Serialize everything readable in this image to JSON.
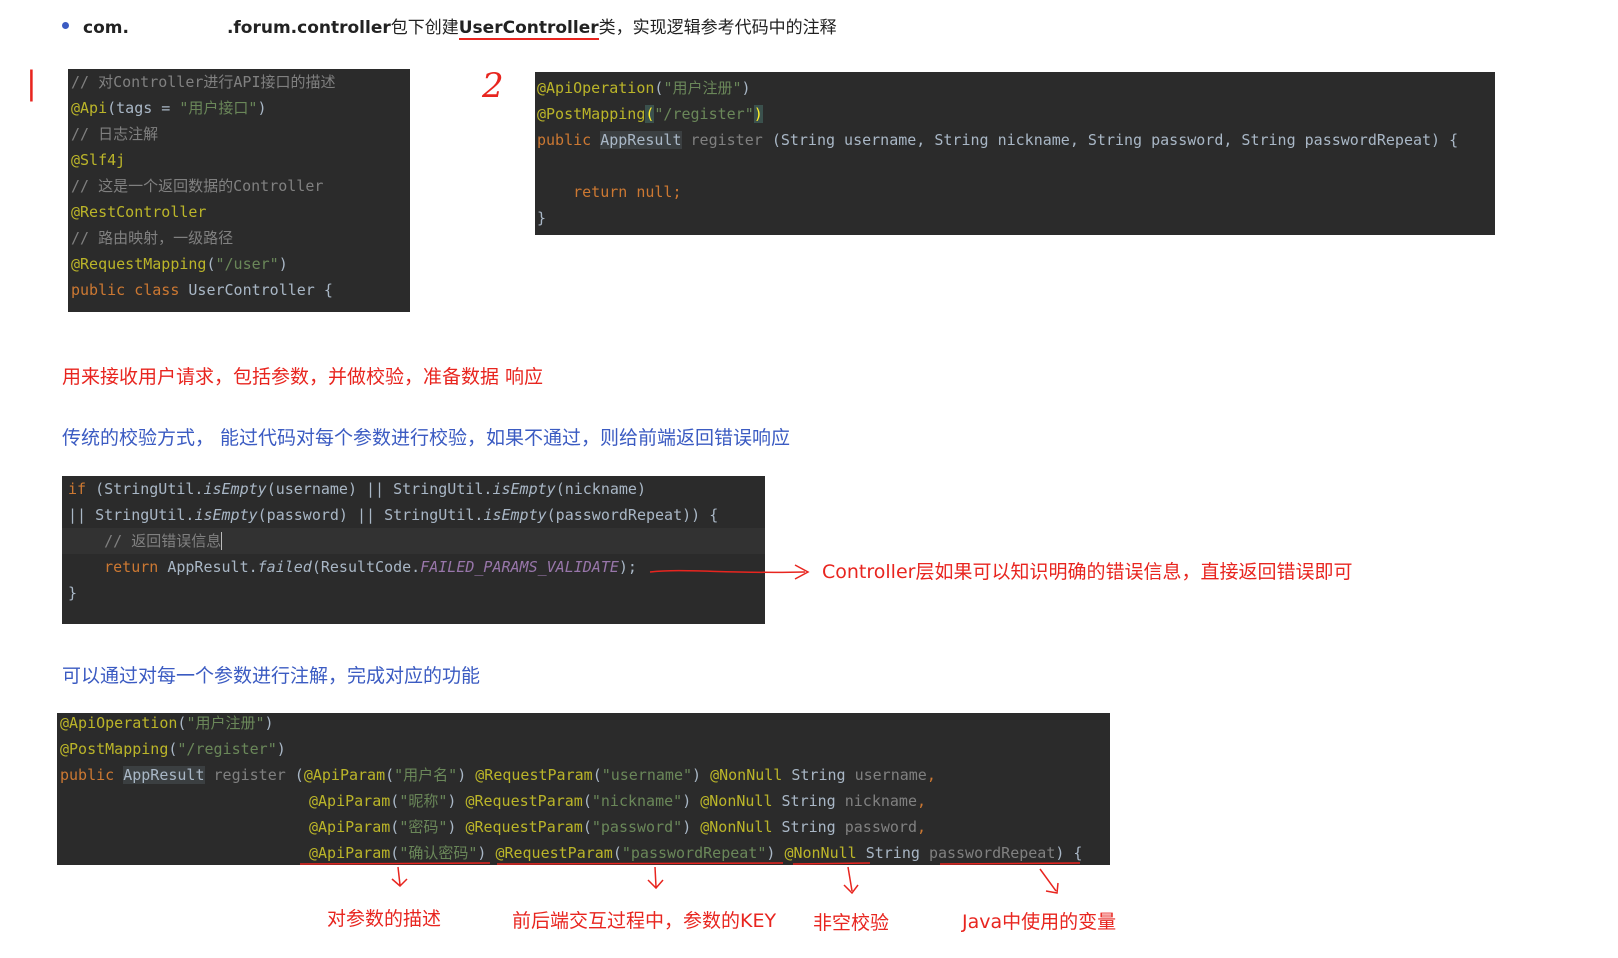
{
  "top_bullet": {
    "pkg_prefix": "com.",
    "pkg_suffix": ".forum.controller",
    "text1": "包下创建",
    "class_name": "UserController",
    "text2": "类，实现逻辑参考代码中的注释"
  },
  "handwritten_marks": {
    "mark1": "|",
    "mark2": "2"
  },
  "code_block_1": {
    "lines": [
      "// 对Controller进行API接口的描述",
      "@Api(tags = \"用户接口\")",
      "// 日志注解",
      "@Slf4j",
      "// 这是一个返回数据的Controller",
      "@RestController",
      "// 路由映射，一级路径",
      "@RequestMapping(\"/user\")",
      "public class UserController {"
    ]
  },
  "code_block_2": {
    "api_operation": "@ApiOperation",
    "api_operation_arg": "\"用户注册\"",
    "post_mapping": "@PostMapping",
    "post_mapping_arg": "\"/register\"",
    "kw_public": "public",
    "type_appresult": "AppResult",
    "method": "register",
    "params": "(String username, String nickname, String password, String passwordRepeat) {",
    "kw_return": "return",
    "ret_val": " null;",
    "close": "}"
  },
  "notes": {
    "note1": "用来接收用户请求，包括参数，并做校验，准备数据   响应",
    "note2": "传统的校验方式，  能过代码对每个参数进行校验，如果不通过，则给前端返回错误响应",
    "note3": "Controller层如果可以知识明确的错误信息，直接返回错误即可",
    "note4": "可以通过对每一个参数进行注解，完成对应的功能"
  },
  "code_block_3": {
    "kw_if": "if",
    "line1_rest": " (StringUtil.",
    "is_empty": "isEmpty",
    "arg_username": "(username) || StringUtil.",
    "arg_nickname": "(nickname)",
    "line2_a": "|| StringUtil.",
    "arg_password": "(password) || StringUtil.",
    "arg_repeat": "(passwordRepeat)) {",
    "comment": "// 返回错误信息",
    "kw_return": "return",
    "appresult": " AppResult.",
    "failed": "failed",
    "rc": "(ResultCode.",
    "const": "FAILED_PARAMS_VALIDATE",
    "end": ");",
    "close": "}"
  },
  "code_block_4": {
    "api_operation": "@ApiOperation",
    "api_operation_arg": "\"用户注册\"",
    "post_mapping": "@PostMapping",
    "post_mapping_arg": "\"/register\"",
    "kw_public": "public",
    "type_appresult": "AppResult",
    "method": "register",
    "params": [
      {
        "desc": "\"用户名\"",
        "key": "\"username\"",
        "var": "username",
        "end": ","
      },
      {
        "desc": "\"昵称\"",
        "key": "\"nickname\"",
        "var": "nickname",
        "end": ","
      },
      {
        "desc": "\"密码\"",
        "key": "\"password\"",
        "var": "password",
        "end": ","
      },
      {
        "desc": "\"确认密码\"",
        "key": "\"passwordRepeat\"",
        "var": "passwordRepeat",
        "end": ") {"
      }
    ],
    "ann_api_param": "@ApiParam",
    "ann_request_param": "@RequestParam",
    "ann_non_null": "@NonNull",
    "type_string": "String"
  },
  "annotations": {
    "a1": "对参数的描述",
    "a2": "前后端交互过程中，参数的KEY",
    "a3": "非空校验",
    "a4": "Java中使用的变量"
  },
  "colors": {
    "red_note": "#e8251f",
    "blue_note": "#3b5bc2",
    "code_bg": "#2b2b2b",
    "bullet": "#3b5bc2"
  }
}
